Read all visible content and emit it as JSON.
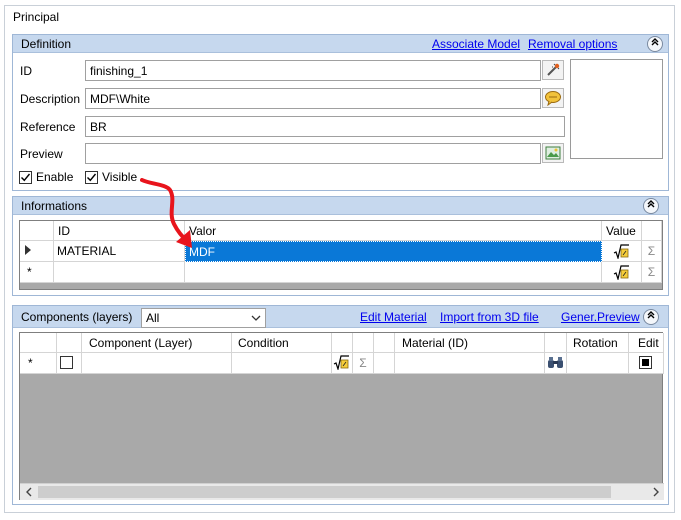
{
  "principal": {
    "title": "Principal"
  },
  "definition": {
    "title": "Definition",
    "associate_model": "Associate Model",
    "removal_options": "Removal options",
    "id_label": "ID",
    "id_value": "finishing_1",
    "description_label": "Description",
    "description_value": "MDF\\White",
    "reference_label": "Reference",
    "reference_value": "BR",
    "preview_label": "Preview",
    "preview_value": "",
    "enable_label": "Enable",
    "visible_label": "Visible",
    "enable_checked": true,
    "visible_checked": true
  },
  "informations": {
    "title": "Informations",
    "columns": {
      "id": "ID",
      "valor": "Valor",
      "value": "Value"
    },
    "rows": [
      {
        "id": "MATERIAL",
        "valor": "MDF"
      }
    ],
    "new_row_marker": "*"
  },
  "components": {
    "title": "Components (layers)",
    "filter_value": "All",
    "edit_material": "Edit Material",
    "import_3d": "Import from 3D file",
    "gener_preview": "Gener.Preview",
    "columns": {
      "component": "Component (Layer)",
      "condition": "Condition",
      "material": "Material (ID)",
      "rotation": "Rotation",
      "edit": "Edit"
    },
    "new_row_marker": "*"
  },
  "icons": {
    "sigma": "Σ",
    "collapse": "︽"
  },
  "colors": {
    "header_bg": "#c6d8ee",
    "selection": "#0a78d7",
    "arrow": "#e8141c",
    "grid_bg": "#a9a9a9"
  }
}
